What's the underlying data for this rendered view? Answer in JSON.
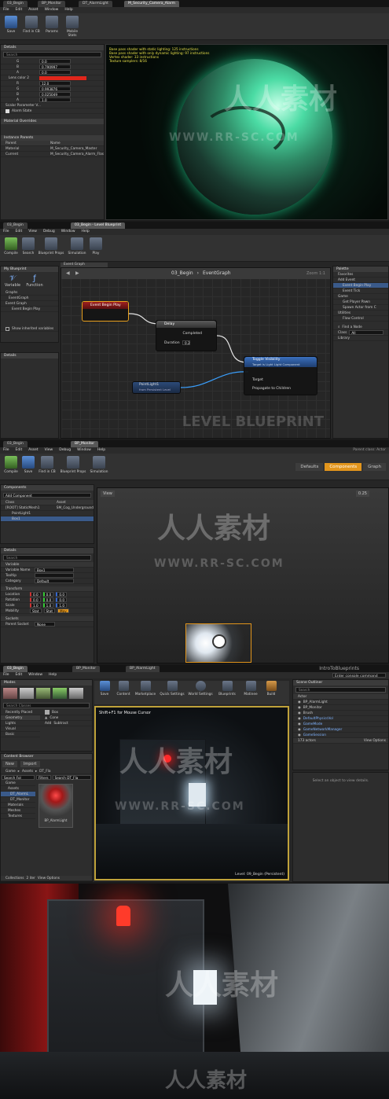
{
  "screen1": {
    "tabs": [
      "03_Begin",
      "BP_Monitor",
      "DT_AlarmLight",
      "M_Security_Camera_Alarm"
    ],
    "toolbar": [
      "Save",
      "Find in CB",
      "Params",
      "Mobile Stats"
    ],
    "details_title": "Details",
    "search_placeholder": "Search",
    "params": [
      {
        "label": "G",
        "value": "0.0"
      },
      {
        "label": "B",
        "value": "0.790997"
      },
      {
        "label": "A",
        "value": "0.0"
      },
      {
        "label": "Lens color 2",
        "value": ""
      },
      {
        "label": "R",
        "value": "12.0"
      },
      {
        "label": "G",
        "value": "0.993876"
      },
      {
        "label": "B",
        "value": "0.025049"
      },
      {
        "label": "A",
        "value": "1.0"
      }
    ],
    "scalar_param": "Scalar Parameter V...",
    "alarm_state": "Alarm State",
    "material_overrides": "Material Overrides",
    "instance_parents": "Instance Parents",
    "parent_header": [
      "Parent",
      "Name"
    ],
    "parents": [
      {
        "k": "Material",
        "v": "M_Security_Camera_Master"
      },
      {
        "k": "Current",
        "v": "M_Security_Camera_Alarm_Flas"
      }
    ],
    "stats": [
      "Base pass shader with static lighting: 125 instructions",
      "Base pass shader with only dynamic lighting: 97 instructions",
      "Vertex shader: 33 instructions",
      "Texture samplers: 8/16"
    ]
  },
  "screen2": {
    "tabs": [
      "03_Begin",
      "03_Begin - Level Blueprint"
    ],
    "menu": [
      "File",
      "Edit",
      "View",
      "Debug",
      "Window",
      "Help"
    ],
    "toolbar": [
      "Compile",
      "Search",
      "Blueprint Props",
      "Simulation",
      "Play"
    ],
    "my_blueprint": "My Blueprint",
    "variable_btn": "Variable",
    "function_btn": "Function",
    "graphs_label": "Graphs",
    "tree": [
      "EventGraph",
      "Event Graph",
      "Event Begin Play"
    ],
    "show_inherited": "Show inherited variables",
    "details_title": "Details",
    "graph_tab": "Event Graph",
    "breadcrumb_root": "03_Begin",
    "breadcrumb_sep": "›",
    "breadcrumb_leaf": "EventGraph",
    "zoom": "Zoom 1:1",
    "nodes": {
      "begin_play": "Event Begin Play",
      "delay": "Delay",
      "completed": "Completed",
      "duration": "Duration",
      "duration_value": "0.2",
      "toggle": "Toggle Visibility",
      "toggle_sub": "Target is Light Light Component",
      "target": "Target",
      "propagate": "Propagate to Children",
      "pointlight": "PointLight1",
      "pointlight_sub": "from Persistent Level"
    },
    "level_blueprint": "LEVEL BLUEPRINT",
    "palette": "Palette",
    "favorites": "Favorites",
    "palette_items": [
      "Add Event",
      "Event Begin Play",
      "Event Tick",
      "Game",
      "Get Player Pawn",
      "Spawn Actor from C",
      "Utilities",
      "Flow Control"
    ],
    "find_node": "Find a Node",
    "class_label": "Class",
    "class_value": "All",
    "library": "Library"
  },
  "screen3": {
    "tabs": [
      "03_Begin",
      "BP_Monitor"
    ],
    "menu": [
      "File",
      "Edit",
      "Asset",
      "View",
      "Debug",
      "Window",
      "Help"
    ],
    "parent_class": "Parent class: Actor",
    "toolbar": [
      "Compile",
      "Save",
      "Find in CB",
      "Blueprint Props",
      "Simulation"
    ],
    "modes": [
      "Defaults",
      "Components",
      "Graph"
    ],
    "components_title": "Components",
    "add_component": "Add Component",
    "comp_headers": [
      "Class",
      "Asset"
    ],
    "comp_rows": [
      {
        "k": "[ROOT] StaticMesh1",
        "v": "SM_Cog_Underground"
      },
      {
        "k": "PointLight1",
        "v": ""
      },
      {
        "k": "Box1",
        "v": ""
      }
    ],
    "details_title": "Details",
    "search_placeholder": "Search",
    "variable": "Variable",
    "var_name_label": "Variable Name",
    "var_name": "Box1",
    "tooltip_label": "Tooltip",
    "category_label": "Category",
    "category": "Default",
    "transform": "Transform",
    "location": "Location",
    "rotation": "Rotation",
    "scale": "Scale",
    "mobility": "Mobility",
    "loc_vals": [
      "0.0",
      "0.0",
      "0.0"
    ],
    "rot_vals": [
      "0.0",
      "0.0",
      "0.0"
    ],
    "scale_vals": [
      "1.0",
      "1.0",
      "1.0"
    ],
    "mobility_opts": [
      "Stat",
      "Stat",
      "Mov"
    ],
    "sockets": "Sockets",
    "parent_socket_label": "Parent Socket",
    "parent_socket": "None",
    "viewport_label": "View",
    "snap": "0.25"
  },
  "screen4": {
    "tabs": [
      "03_Begin",
      "BP_Monitor",
      "BP_AlarmLight"
    ],
    "project": "IntroToBlueprints",
    "menu": [
      "File",
      "Edit",
      "Window",
      "Help"
    ],
    "search_cmd": "Enter console command",
    "modes_title": "Modes",
    "search_classes": "Search Classes",
    "categories": [
      "Recently Placed",
      "Geometry",
      "Lights",
      "Visual",
      "Basic"
    ],
    "place_items": [
      "Box",
      "Cone",
      "Add",
      "Subtract"
    ],
    "toolbar": [
      "Save",
      "Content",
      "Marketplace",
      "Quick Settings",
      "World Settings",
      "Blueprints",
      "Matinee",
      "Build"
    ],
    "vp_hint": "Shift+F1 for Mouse Cursor",
    "level_label": "Level:  09_Begin (Persistent)",
    "content_browser": "Content Browser",
    "new_btn": "New",
    "import_btn": "Import",
    "path": [
      "Game",
      "Assets",
      "DT_Fla"
    ],
    "search_folders": "Search Fol",
    "filters": "Filters",
    "search_content": "Search DT_Fla",
    "folders": [
      "Game",
      "Assets",
      "DT_AlarmL",
      "DT_Monitor",
      "Materials",
      "Meshes",
      "Textures"
    ],
    "asset": "BP_AlarmLight",
    "item_count": "2 iter",
    "view_options": "View Options",
    "collections": "Collections",
    "outliner_title": "Scene Outliner",
    "outliner_search": "Search",
    "actor_header": "Actor",
    "actors": [
      "BP_AlarmLight",
      "BP_Monitor",
      "Brush",
      "DefaultPhysicsVol",
      "GameMode",
      "GameNetworkManager",
      "GameSession"
    ],
    "actor_count": "173 actors",
    "outliner_view": "View Options",
    "details_hint": "Select an object to view details."
  },
  "watermark": {
    "cn": "人人素材",
    "url": "WWW.RR-SC.COM"
  }
}
